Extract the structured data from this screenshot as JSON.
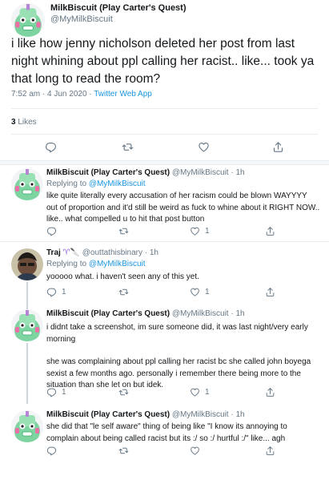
{
  "main_tweet": {
    "author_name": "MilkBiscuit (Play Carter's Quest)",
    "author_handle": "@MyMilkBiscuit",
    "text": "i like how jenny nicholson deleted her post from last night whining about ppl calling her racist.. like... took ya that long to read the room?",
    "time": "7:52 am · 4 Jun 2020 · ",
    "source": "Twitter Web App",
    "likes_count": "3",
    "likes_label": " Likes"
  },
  "replies": [
    {
      "name": "MilkBiscuit (Play Carter's Quest)",
      "handle": " @MyMilkBiscuit · 1h",
      "replying_prefix": "Replying to ",
      "replying_to": "@MyMilkBiscuit",
      "text": "like quite literally every accusation of her racism could be blown WAYYYY out of proportion and it'd still be weird as fuck to whine about it RIGHT NOW.. like.. what compelled u to hit that post button",
      "reply_count": "",
      "like_count": "1"
    },
    {
      "name": "Traj",
      "badges": "♈🔪",
      "handle": " @outtathisbinary · 1h",
      "replying_prefix": "Replying to ",
      "replying_to": "@MyMilkBiscuit",
      "text": "yooooo what. i haven't seen any of this yet.",
      "reply_count": "1",
      "like_count": "1"
    },
    {
      "name": "MilkBiscuit (Play Carter's Quest)",
      "handle": " @MyMilkBiscuit · 1h",
      "text_1": "i didnt take a screenshot, im sure someone did, it was last night/very early morning",
      "text_2": "she was complaining about ppl calling her racist bc she called john boyega sexist a few months ago. personally i remember there being more to the situation than she let on but idek.",
      "reply_count": "1",
      "like_count": "1"
    },
    {
      "name": "MilkBiscuit (Play Carter's Quest)",
      "handle": " @MyMilkBiscuit · 1h",
      "text": "she did that \"le self aware\" thing of being like \"I know its annoying to complain about being called racist but its :/ so :/ hurtful :/\" like... agh",
      "reply_count": "",
      "like_count": ""
    }
  ],
  "colors": {
    "text": "#14171a",
    "muted": "#657786",
    "link": "#1b95e0",
    "divider": "#e6ecf0"
  },
  "icons": [
    "reply-icon",
    "retweet-icon",
    "like-icon",
    "share-icon"
  ]
}
